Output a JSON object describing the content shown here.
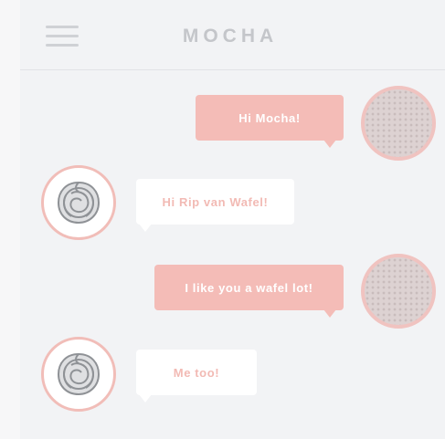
{
  "header": {
    "title": "MOCHA",
    "menu_icon": "hamburger-menu-icon"
  },
  "colors": {
    "outgoing_bubble": "#f4bcb7",
    "incoming_text": "#f2bab4",
    "title_text": "#c4c6ca",
    "background": "#f2f3f5"
  },
  "messages": [
    {
      "from": "user",
      "text": "Hi Mocha!",
      "avatar": "user-avatar"
    },
    {
      "from": "mocha",
      "text": "Hi Rip van Wafel!",
      "avatar": "rose-avatar"
    },
    {
      "from": "user",
      "text": "I like you a wafel lot!",
      "avatar": "user-avatar"
    },
    {
      "from": "mocha",
      "text": "Me too!",
      "avatar": "rose-avatar"
    }
  ]
}
